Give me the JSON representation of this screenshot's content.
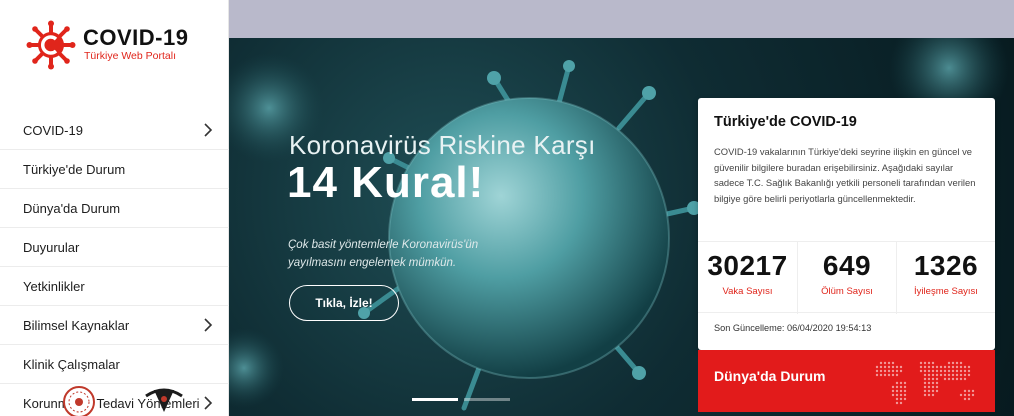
{
  "logo": {
    "title": "COVID-19",
    "subtitle": "Türkiye Web Portalı"
  },
  "nav": [
    {
      "label": "COVID-19",
      "has_submenu": true
    },
    {
      "label": "Türkiye'de Durum",
      "has_submenu": false
    },
    {
      "label": "Dünya'da Durum",
      "has_submenu": false
    },
    {
      "label": "Duyurular",
      "has_submenu": false
    },
    {
      "label": "Yetkinlikler",
      "has_submenu": false
    },
    {
      "label": "Bilimsel Kaynaklar",
      "has_submenu": true
    },
    {
      "label": "Klinik Çalışmalar",
      "has_submenu": false
    },
    {
      "label": "Korunma ve Tedavi Yöntemleri",
      "has_submenu": true
    }
  ],
  "hero": {
    "title_line1": "Koronavirüs Riskine Karşı",
    "title_line2": "14 Kural!",
    "description": "Çok basit yöntemlerle Koronavirüs'ün yayılmasını engelemek mümkün.",
    "button_label": "Tıkla, İzle!"
  },
  "card": {
    "title": "Türkiye'de COVID-19",
    "text": "COVID-19 vakalarının Türkiye'deki seyrine ilişkin en güncel ve güvenilir bilgilere buradan erişebilirsiniz. Aşağıdaki sayılar sadece T.C. Sağlık Bakanlığı yetkili personeli tarafından verilen bilgiye göre belirli periyotlarla güncellenmektedir.",
    "stats": [
      {
        "value": "30217",
        "label": "Vaka Sayısı"
      },
      {
        "value": "649",
        "label": "Ölüm Sayısı"
      },
      {
        "value": "1326",
        "label": "İyileşme Sayısı"
      }
    ],
    "updated": "Son Güncelleme: 06/04/2020 19:54:13",
    "world_label": "Dünya'da Durum"
  },
  "colors": {
    "brand_red": "#e0251b",
    "world_red": "#e21b1b",
    "topbar": "#b9b9cb"
  },
  "icons": {
    "logo": "virus-logo-icon",
    "submenu": "chevron-right-icon"
  }
}
